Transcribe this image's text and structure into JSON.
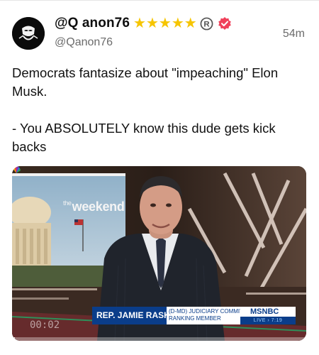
{
  "post": {
    "display_name": "@Q anon76",
    "handle": "@Qanon76",
    "timestamp": "54m",
    "star_count": 5,
    "text_line1": "Democrats fantasize about \"impeaching\" Elon Musk.",
    "text_line2": "- You ABSOLUTELY know this dude gets kick backs"
  },
  "video": {
    "elapsed": "00:02",
    "progress": 0.01,
    "show_logo_prefix": "the",
    "show_logo": "weekend",
    "chyron_name": "REP. JAMIE RASKIN",
    "chyron_info_line1": "(D-MD) JUDICIARY COMMITTEE",
    "chyron_info_line2": "RANKING MEMBER",
    "network": "MSNBC",
    "live_label": "LIVE",
    "live_time": "7:19"
  },
  "colors": {
    "star": "#f6c500",
    "verified": "#f0405a",
    "chyron_blue": "#0a3d8a"
  },
  "icons": {
    "avatar": "anonymous-mask-icon",
    "registered": "registered-mark-icon",
    "verified": "verified-badge-icon"
  }
}
